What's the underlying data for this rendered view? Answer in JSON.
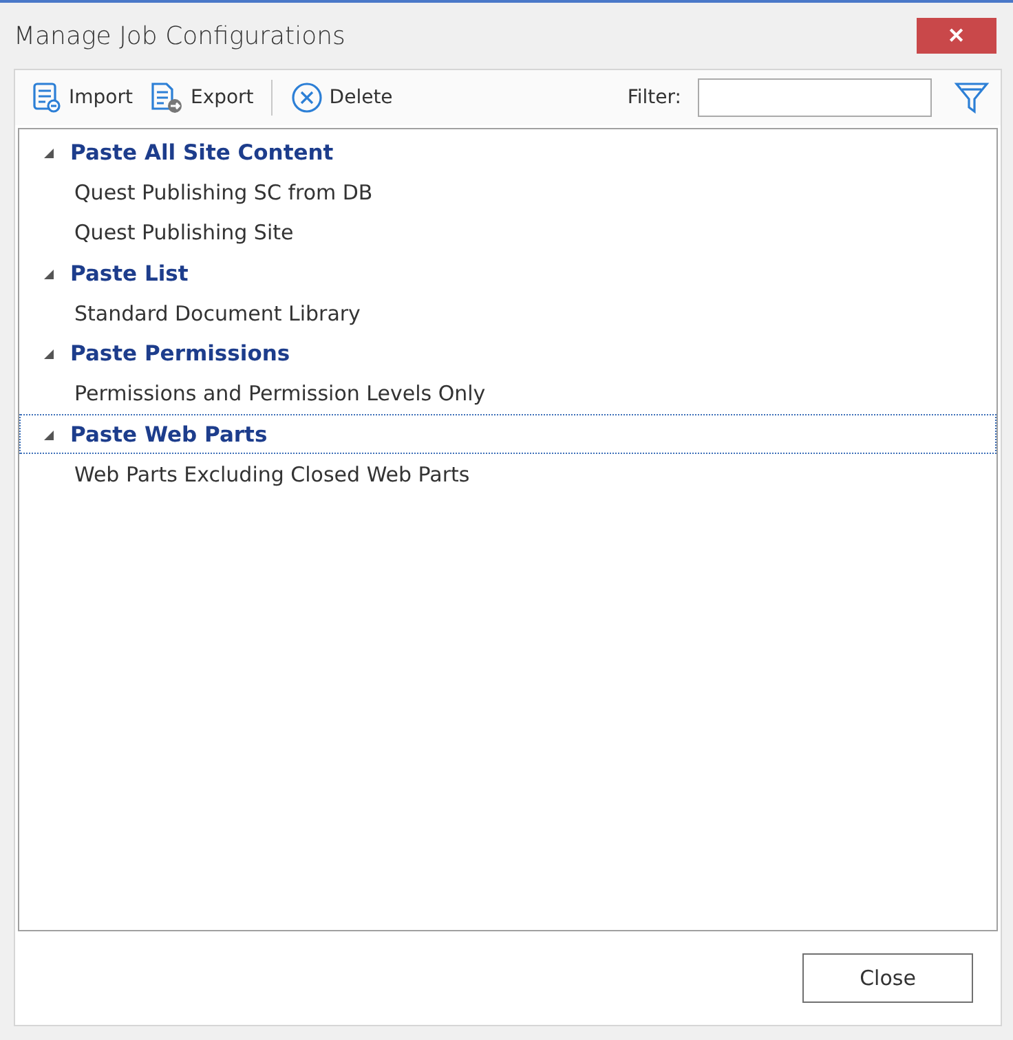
{
  "window": {
    "title": "Manage Job Configurations",
    "close_glyph": "✕"
  },
  "toolbar": {
    "buttons": [
      {
        "kind": "import",
        "label": "Import"
      },
      {
        "kind": "export",
        "label": "Export"
      },
      {
        "kind": "delete",
        "label": "Delete"
      }
    ],
    "filter_label": "Filter:"
  },
  "tree": [
    {
      "label": "Paste All Site Content",
      "expanded": true,
      "selected": false,
      "children": [
        {
          "label": "Quest Publishing SC from DB"
        },
        {
          "label": "Quest Publishing Site"
        }
      ]
    },
    {
      "label": "Paste List",
      "expanded": true,
      "selected": false,
      "children": [
        {
          "label": "Standard Document Library"
        }
      ]
    },
    {
      "label": "Paste Permissions",
      "expanded": true,
      "selected": false,
      "children": [
        {
          "label": "Permissions and Permission Levels Only"
        }
      ]
    },
    {
      "label": "Paste Web Parts",
      "expanded": true,
      "selected": true,
      "children": [
        {
          "label": "Web Parts Excluding Closed Web Parts"
        }
      ]
    }
  ],
  "footer": {
    "close_button": "Close"
  }
}
